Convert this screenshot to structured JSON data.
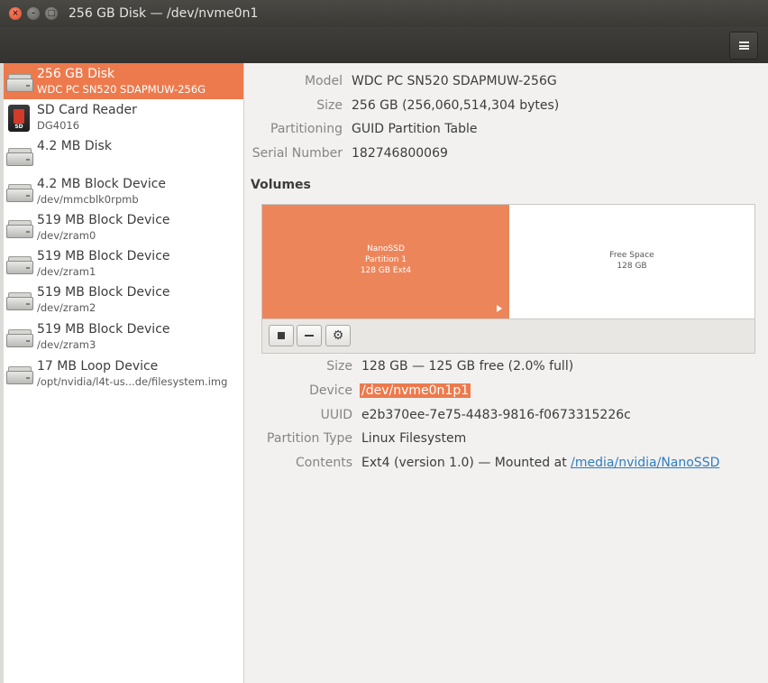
{
  "window": {
    "title": "256 GB Disk — /dev/nvme0n1"
  },
  "titlebar_buttons": {
    "close": "×",
    "minimize": "–",
    "maximize": "□"
  },
  "sidebar": {
    "items": [
      {
        "name": "256 GB Disk",
        "sub": "WDC PC SN520 SDAPMUW-256G",
        "icon": "drive-icon",
        "selected": true
      },
      {
        "name": "SD Card Reader",
        "sub": "DG4016",
        "icon": "sd-card-icon",
        "icon_text": "SD"
      },
      {
        "name": "4.2 MB Disk",
        "sub": "",
        "icon": "drive-icon"
      },
      {
        "name": "4.2 MB Block Device",
        "sub": "/dev/mmcblk0rpmb",
        "icon": "drive-icon"
      },
      {
        "name": "519 MB Block Device",
        "sub": "/dev/zram0",
        "icon": "drive-icon"
      },
      {
        "name": "519 MB Block Device",
        "sub": "/dev/zram1",
        "icon": "drive-icon"
      },
      {
        "name": "519 MB Block Device",
        "sub": "/dev/zram2",
        "icon": "drive-icon"
      },
      {
        "name": "519 MB Block Device",
        "sub": "/dev/zram3",
        "icon": "drive-icon"
      },
      {
        "name": "17 MB Loop Device",
        "sub": "/opt/nvidia/l4t-us...de/filesystem.img",
        "icon": "drive-icon"
      }
    ]
  },
  "disk": {
    "model_label": "Model",
    "model": "WDC PC SN520 SDAPMUW-256G",
    "size_label": "Size",
    "size": "256 GB (256,060,514,304 bytes)",
    "partitioning_label": "Partitioning",
    "partitioning": "GUID Partition Table",
    "serial_label": "Serial Number",
    "serial": "182746800069"
  },
  "volumes": {
    "heading": "Volumes",
    "partition": {
      "line1": "NanoSSD",
      "line2": "Partition 1",
      "line3": "128 GB Ext4"
    },
    "free": {
      "line1": "Free Space",
      "line2": "128 GB"
    },
    "colors": {
      "partition": "#ed855b",
      "selection": "#ed7a4d"
    }
  },
  "volume_details": {
    "size_label": "Size",
    "size": "128 GB — 125 GB free (2.0% full)",
    "device_label": "Device",
    "device": "/dev/nvme0n1p1",
    "uuid_label": "UUID",
    "uuid": "e2b370ee-7e75-4483-9816-f0673315226c",
    "ptype_label": "Partition Type",
    "ptype": "Linux Filesystem",
    "contents_label": "Contents",
    "contents_prefix": "Ext4 (version 1.0) — Mounted at ",
    "mount_link": "/media/nvidia/NanoSSD"
  }
}
